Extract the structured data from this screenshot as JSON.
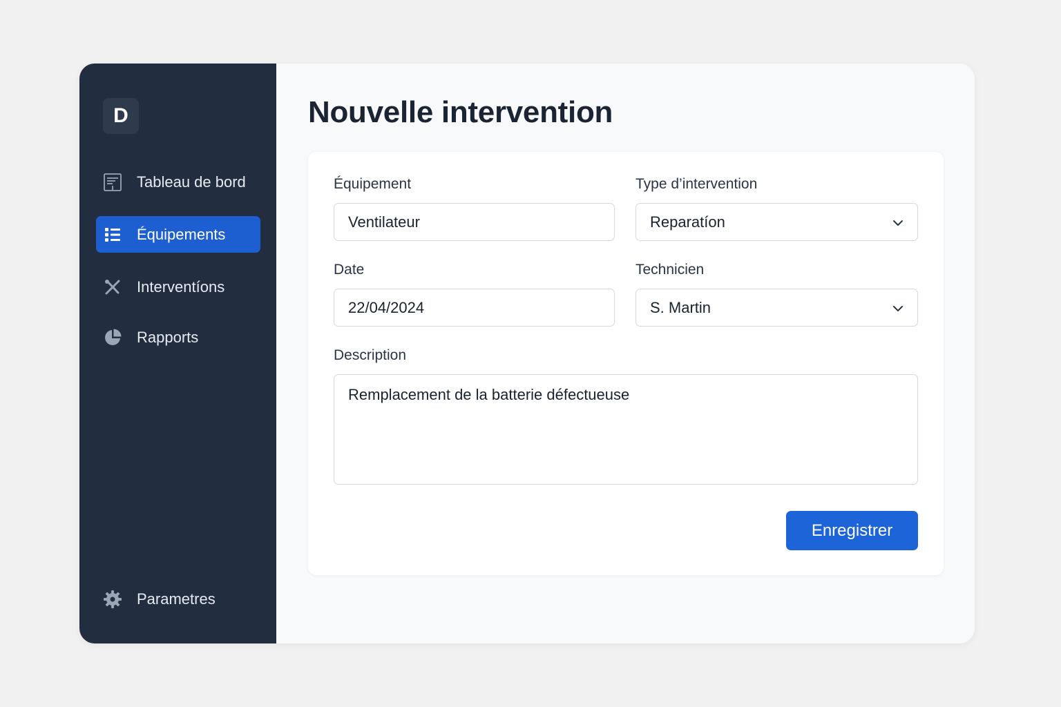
{
  "sidebar": {
    "logo_letter": "D",
    "items": [
      {
        "label": "Tableau de bord",
        "icon": "dashboard-icon",
        "active": false
      },
      {
        "label": "Équipements",
        "icon": "list-icon",
        "active": true
      },
      {
        "label": "Interventíons",
        "icon": "tools-icon",
        "active": false
      },
      {
        "label": "Rapports",
        "icon": "pie-chart-icon",
        "active": false
      }
    ],
    "settings": {
      "label": "Parametres",
      "icon": "gear-icon"
    }
  },
  "main": {
    "title": "Nouvelle intervention",
    "form": {
      "equipment": {
        "label": "Équipement",
        "value": "Ventilateur"
      },
      "type": {
        "label": "Type d’intervention",
        "value": "Reparatíon"
      },
      "date": {
        "label": "Date",
        "value": "22/04/2024"
      },
      "technician": {
        "label": "Technicien",
        "value": "S. Martin"
      },
      "description": {
        "label": "Description",
        "value": "Remplacement de la batterie défectueuse"
      },
      "save_label": "Enregistrer"
    }
  },
  "colors": {
    "sidebar_bg": "#222e3f",
    "accent": "#1d5fd1",
    "button": "#1d64d8"
  }
}
